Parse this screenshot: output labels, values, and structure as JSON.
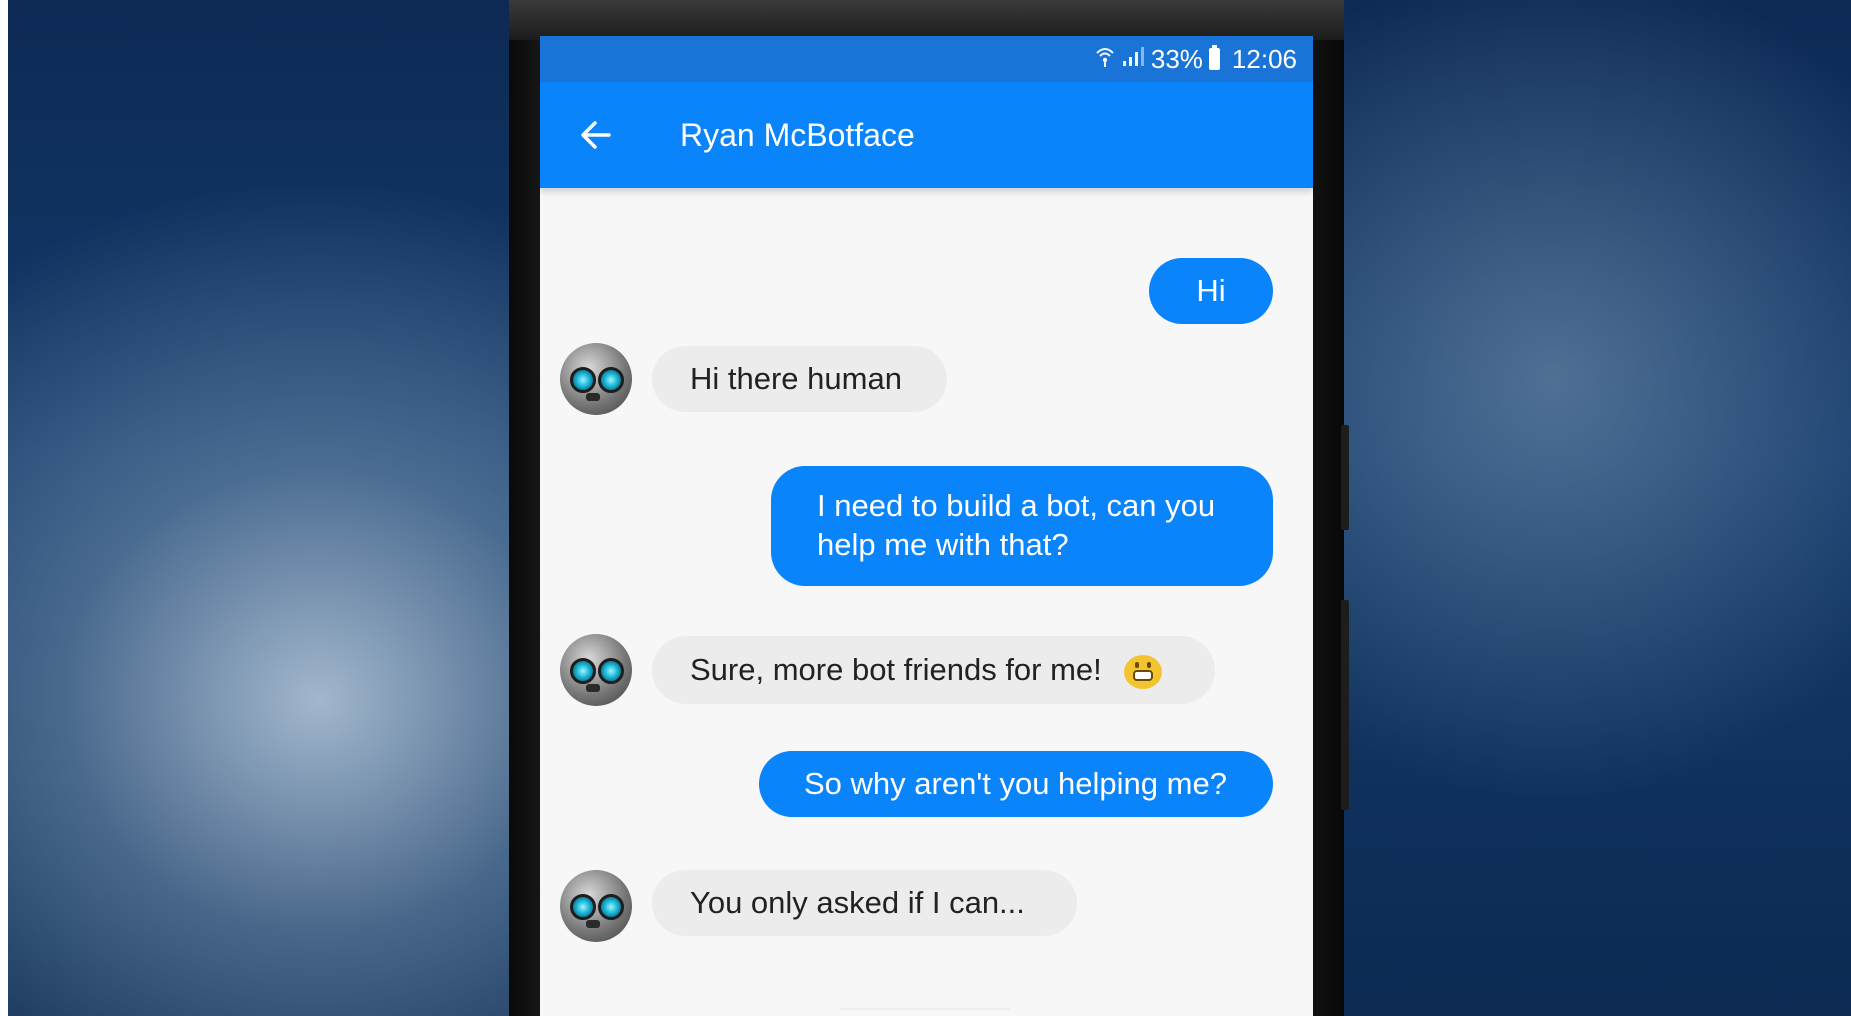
{
  "status_bar": {
    "wifi_icon": "wifi-icon",
    "signal_icon": "signal-icon",
    "battery_percent": "33%",
    "battery_icon": "battery-icon",
    "time": "12:06"
  },
  "app_bar": {
    "back_icon": "arrow-left-icon",
    "title": "Ryan McBotface"
  },
  "colors": {
    "status_bar": "#1a74d8",
    "app_bar": "#0a84fa",
    "outgoing_bubble": "#0a84fa",
    "incoming_bubble": "#ececec"
  },
  "messages": [
    {
      "sender": "me",
      "text": "Hi"
    },
    {
      "sender": "bot",
      "text": "Hi there human"
    },
    {
      "sender": "me",
      "lines": [
        "I need to build a bot, can you",
        "help me with that?"
      ]
    },
    {
      "sender": "bot",
      "text": "Sure, more bot friends for me!",
      "emoji": "grinning-face-icon"
    },
    {
      "sender": "me",
      "text": "So why aren't you helping me?"
    },
    {
      "sender": "bot",
      "text": "You only asked if I can..."
    }
  ]
}
